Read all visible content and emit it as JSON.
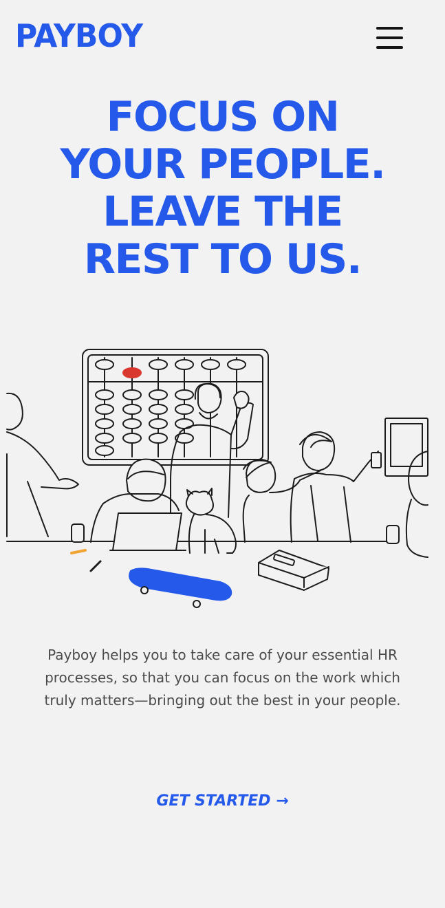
{
  "header": {
    "logo": "PAYBOY",
    "menu_icon": "hamburger-menu-icon"
  },
  "hero": {
    "title_lines": [
      "FOCUS ON",
      "YOUR PEOPLE.",
      "LEAVE THE",
      "REST TO US."
    ]
  },
  "illustration": {
    "icon": "team-illustration"
  },
  "description": {
    "text": "Payboy helps you to take care of your essential HR processes, so that you can focus on the work which truly matters—bringing out the best in your people."
  },
  "cta": {
    "label": "GET STARTED",
    "arrow": "→"
  },
  "colors": {
    "brand": "#2459ea",
    "background": "#f2f2f3",
    "text": "#4a4a4a",
    "accent_red": "#d8382d",
    "accent_orange": "#f0a431"
  }
}
